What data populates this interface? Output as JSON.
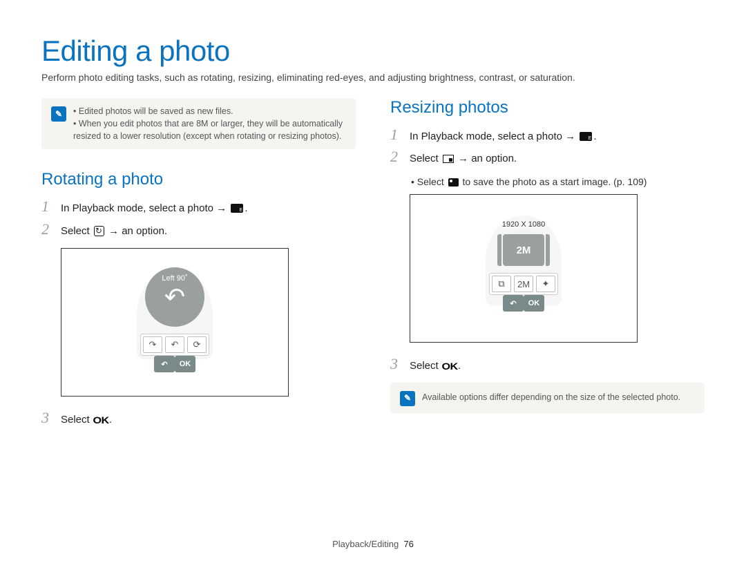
{
  "title": "Editing a photo",
  "intro": "Perform photo editing tasks, such as rotating, resizing, eliminating red-eyes, and adjusting brightness, contrast, or saturation.",
  "top_note": {
    "items": [
      "Edited photos will be saved as new files.",
      "When you edit photos that are 8M or larger, they will be automatically resized to a lower resolution (except when rotating or resizing photos)."
    ],
    "size_badge": "8M"
  },
  "left": {
    "heading": "Rotating a photo",
    "steps": {
      "s1a": "In Playback mode, select a photo →",
      "s1b": ".",
      "s2a": "Select",
      "s2b": "→ an option.",
      "s3a": "Select",
      "s3b": "."
    },
    "screen": {
      "label": "Left 90˚",
      "back": "↶",
      "ok": "OK",
      "toolbar": [
        "↷",
        "↶",
        "⟳"
      ]
    }
  },
  "right": {
    "heading": "Resizing photos",
    "steps": {
      "s1a": "In Playback mode, select a photo →",
      "s1b": ".",
      "s2a": "Select",
      "s2b": "→ an option.",
      "sub_a": "Select",
      "sub_b": "to save the photo as a start image. (p. 109)",
      "s3a": "Select",
      "s3b": "."
    },
    "screen": {
      "dim": "1920 X 1080",
      "badge": "2M",
      "back": "↶",
      "ok": "OK",
      "toolbar": [
        "⧉",
        "2M",
        "✦"
      ]
    },
    "note": "Available options differ depending on the size of the selected photo."
  },
  "ok_glyph": "OK",
  "footer": {
    "section": "Playback/Editing",
    "page": "76"
  }
}
